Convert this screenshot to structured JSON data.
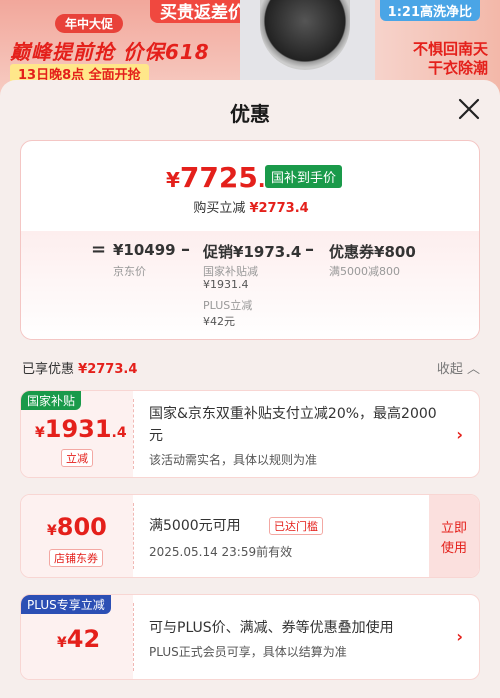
{
  "banner": {
    "tag": "年中大促",
    "title": "巅峰提前抢 价保618",
    "subtitle": "13日晚8点 全面开抢",
    "center_top": "买贵返差价",
    "right_top": "1:21高洗净比",
    "right_text_1": "不惧回南天",
    "right_text_2": "干衣除潮"
  },
  "sheet": {
    "title": "优惠"
  },
  "summary": {
    "price_symbol": "¥",
    "price_int": "7725",
    "price_dec": ".6",
    "badge": "国补到手价",
    "buy_label": "购买立减",
    "buy_amount": "¥2773.4",
    "eq": "=",
    "base_price": "¥10499",
    "base_label": "京东价",
    "minus1": "–",
    "promo_label": "促销",
    "promo_value": "¥1973.4",
    "promo_sub1": "国家补贴减",
    "promo_sub1_val": "¥1931.4",
    "promo_sub2": "PLUS立减",
    "promo_sub2_val": "¥42元",
    "minus2": "–",
    "coupon_label": "优惠券",
    "coupon_value": "¥800",
    "coupon_sub": "满5000减800"
  },
  "enjoyed": {
    "label": "已享优惠",
    "amount": "¥2773.4",
    "collapse": "收起"
  },
  "coupons": [
    {
      "tag": "国家补贴",
      "tag_color": "#1a9a4a",
      "symbol": "¥",
      "amount": "1931",
      "decimal": ".4",
      "small": "立减",
      "desc": "国家&京东双重补贴支付立减20%，最高2000元",
      "desc2": "该活动需实名，具体以规则为准"
    },
    {
      "symbol": "¥",
      "amount": "800",
      "small": "店铺东券",
      "desc": "满5000元可用",
      "reached": "已达门槛",
      "desc2": "2025.05.14 23:59前有效",
      "use_1": "立即",
      "use_2": "使用"
    },
    {
      "tag": "PLUS专享立减",
      "tag_color": "#2c4fb4",
      "symbol": "¥",
      "amount": "42",
      "desc": "可与PLUS价、满减、券等优惠叠加使用",
      "desc2": "PLUS正式会员可享，具体以结算为准"
    }
  ]
}
